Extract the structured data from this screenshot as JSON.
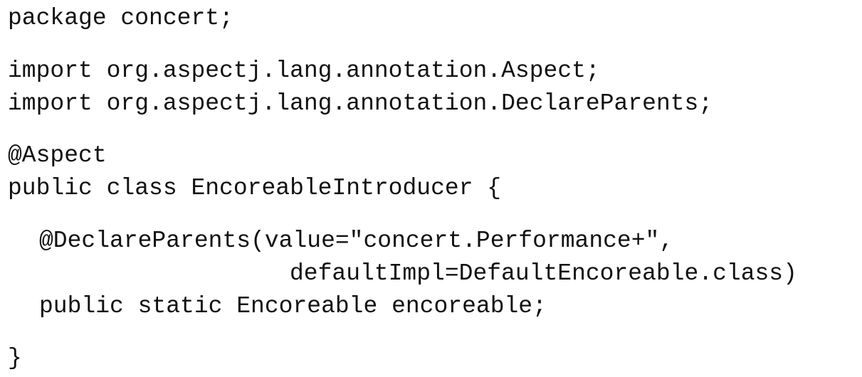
{
  "code": {
    "lines": [
      "package concert;",
      "import org.aspectj.lang.annotation.Aspect;",
      "import org.aspectj.lang.annotation.DeclareParents;",
      "@Aspect",
      "public class EncoreableIntroducer {",
      "@DeclareParents(value=\"concert.Performance+\",",
      "defaultImpl=DefaultEncoreable.class)",
      "public static Encoreable encoreable;",
      "}"
    ]
  }
}
